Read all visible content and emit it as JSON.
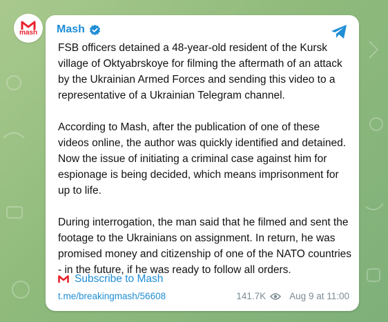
{
  "channel": {
    "name": "Mash",
    "avatar_text": "mash",
    "brand_color": "#e8222c",
    "accent_color": "#1f8ed6"
  },
  "post": {
    "paragraphs": [
      "FSB officers detained a 48-year-old resident of the Kursk village of Oktyabrskoye for filming the aftermath of an attack by the Ukrainian Armed Forces and sending this video to a representative of a Ukrainian Telegram channel.",
      "According to Mash, after the publication of one of these videos online, the author was quickly identified and detained. Now the issue of initiating a criminal case against him for espionage is being decided, which means imprisonment for up to life.",
      "During interrogation, the man said that he filmed and sent the footage to the Ukrainians on assignment. In return, he was promised money and citizenship of one of the NATO countries - in the future, if he was ready to follow all orders."
    ],
    "subscribe_label": "Subscribe to Mash",
    "link": "t.me/breakingmash/56608",
    "views": "141.7K",
    "date": "Aug 9 at 11:00"
  },
  "icons": {
    "verified": "verified-badge-icon",
    "share": "telegram-share-icon",
    "views": "eye-icon",
    "logo": "mash-logo-icon"
  }
}
